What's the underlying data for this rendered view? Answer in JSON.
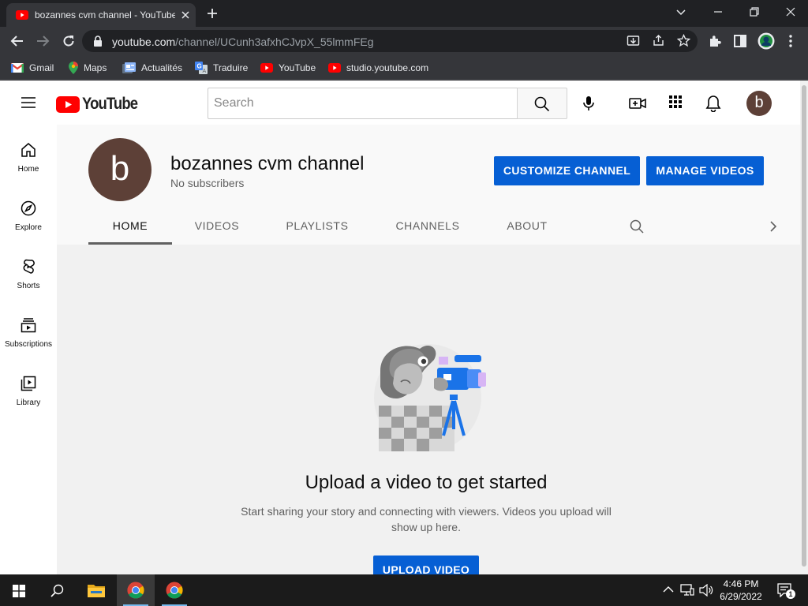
{
  "browser": {
    "tab_title": "bozannes cvm channel - YouTube",
    "url_host": "youtube.com",
    "url_path": "/channel/UCunh3afxhCJvpX_55lmmFEg",
    "bookmarks": [
      "Gmail",
      "Maps",
      "Actualités",
      "Traduire",
      "YouTube",
      "studio.youtube.com"
    ]
  },
  "masthead": {
    "logo_text": "YouTube",
    "search_placeholder": "Search",
    "avatar_letter": "b"
  },
  "guide": {
    "items": [
      {
        "label": "Home",
        "icon": "home-icon"
      },
      {
        "label": "Explore",
        "icon": "compass-icon"
      },
      {
        "label": "Shorts",
        "icon": "shorts-icon"
      },
      {
        "label": "Subscriptions",
        "icon": "subscriptions-icon"
      },
      {
        "label": "Library",
        "icon": "library-icon"
      }
    ]
  },
  "channel": {
    "avatar_letter": "b",
    "name": "bozannes cvm channel",
    "subscribers": "No subscribers",
    "customize_label": "CUSTOMIZE CHANNEL",
    "manage_label": "MANAGE VIDEOS",
    "tabs": [
      "HOME",
      "VIDEOS",
      "PLAYLISTS",
      "CHANNELS",
      "ABOUT"
    ],
    "active_tab": "HOME"
  },
  "empty_state": {
    "title": "Upload a video to get started",
    "description": "Start sharing your story and connecting with viewers. Videos you upload will show up here.",
    "upload_label": "UPLOAD VIDEO"
  },
  "taskbar": {
    "time": "4:46 PM",
    "date": "6/29/2022",
    "notification_count": "1"
  },
  "colors": {
    "youtube_red": "#ff0000",
    "button_blue": "#065fd4",
    "avatar_brown": "#5d4037"
  }
}
